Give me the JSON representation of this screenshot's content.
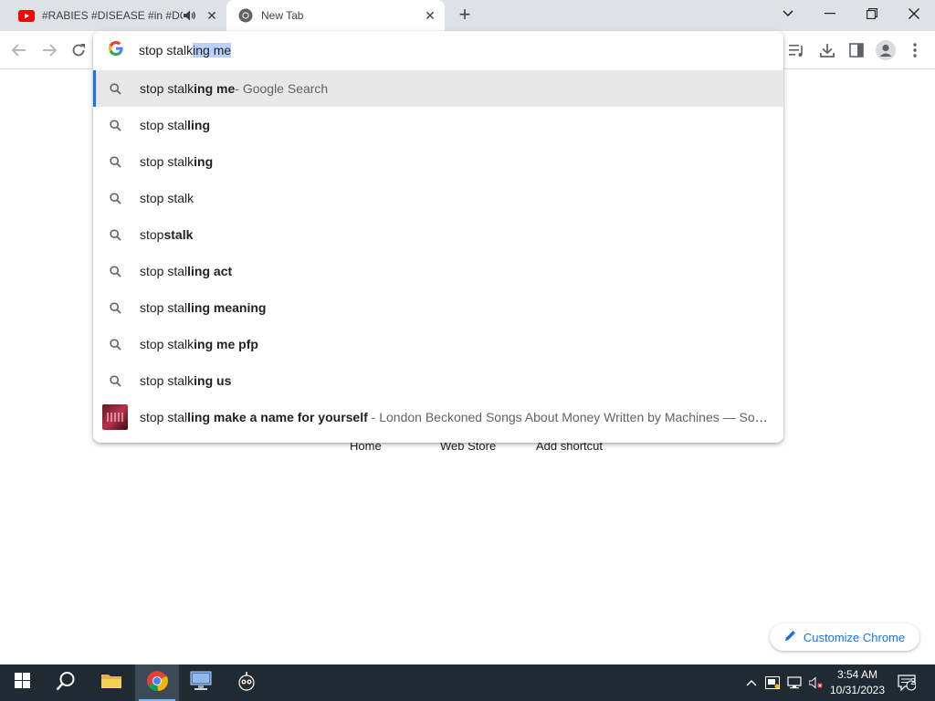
{
  "tabs": [
    {
      "title": "#RABIES #DISEASE #in #DO",
      "favicon": "youtube-icon",
      "audio": true
    },
    {
      "title": "New Tab",
      "favicon": "chrome-icon",
      "active": true
    }
  ],
  "omnibox": {
    "typed_text": "stop stalk",
    "selected_text": "ing me",
    "engine_logo": "G"
  },
  "suggestions": [
    {
      "normal": "stop stalk",
      "bold": "ing me",
      "desc": " - Google Search",
      "active": true
    },
    {
      "normal": "stop stal",
      "bold": "ling"
    },
    {
      "normal": "stop stalk",
      "bold": "ing"
    },
    {
      "normal": "stop stalk",
      "bold": ""
    },
    {
      "normal": "stop",
      "bold": "stalk"
    },
    {
      "normal": "stop stal",
      "bold": "ling act"
    },
    {
      "normal": "stop stal",
      "bold": "ling meaning"
    },
    {
      "normal": "stop stalk",
      "bold": "ing me pfp"
    },
    {
      "normal": "stop stalk",
      "bold": "ing us"
    },
    {
      "normal": "stop stal",
      "bold": "ling make a name for yourself",
      "desc": " - London Beckoned Songs About Money Written by Machines — Son...",
      "thumbnail": true
    }
  ],
  "ntp": {
    "links": [
      "Home",
      "Web Store",
      "Add shortcut"
    ],
    "customize_label": "Customize Chrome"
  },
  "taskbar": {
    "time": "3:54 AM",
    "date": "10/31/2023",
    "notification_count": "2"
  },
  "colors": {
    "accent": "#1a73e8",
    "selection": "#b9d1f8",
    "taskbar": "#1f2a33"
  }
}
